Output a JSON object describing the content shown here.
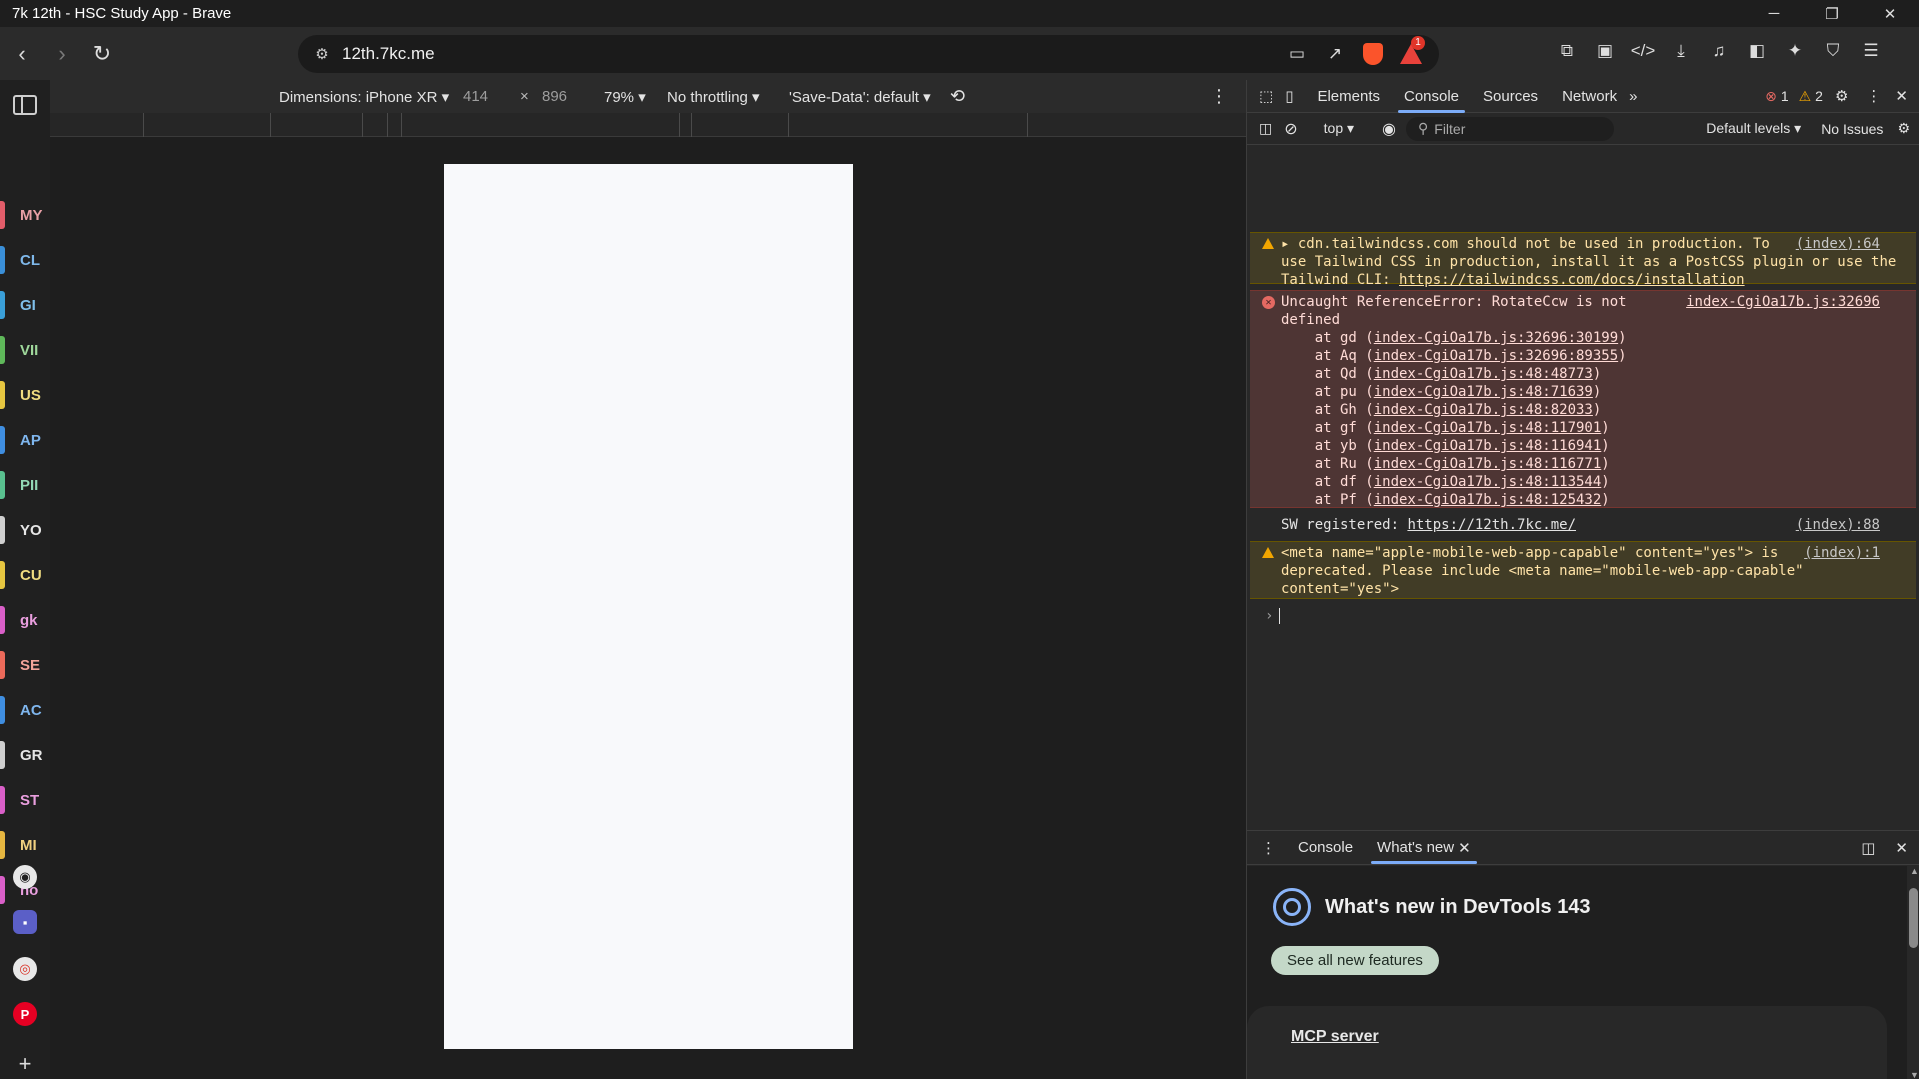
{
  "window": {
    "title": "7k 12th - HSC Study App - Brave"
  },
  "toolbar": {
    "url": "12th.7kc.me",
    "rewards_count": "1"
  },
  "sidebar": {
    "items": [
      {
        "label": "MY",
        "color": "#e35d6a",
        "text_color": "#e8a0a6"
      },
      {
        "label": "CL",
        "color": "#3a8fd8",
        "text_color": "#7fb8ea"
      },
      {
        "label": "GI",
        "color": "#3a9fd8",
        "text_color": "#7fbfea"
      },
      {
        "label": "VII",
        "color": "#5fb85a",
        "text_color": "#9fd89b"
      },
      {
        "label": "US",
        "color": "#e6c640",
        "text_color": "#f0dc80"
      },
      {
        "label": "AP",
        "color": "#3f8ee0",
        "text_color": "#7fb6ee"
      },
      {
        "label": "PII",
        "color": "#59c08f",
        "text_color": "#93d8b6"
      },
      {
        "label": "YO",
        "color": "#cfcfcf",
        "text_color": "#e6e6e6"
      },
      {
        "label": "CU",
        "color": "#e6c640",
        "text_color": "#f0dc80"
      },
      {
        "label": "gk",
        "color": "#d95fc8",
        "text_color": "#ea9fdf"
      },
      {
        "label": "SE",
        "color": "#ec6a5a",
        "text_color": "#f3a59a"
      },
      {
        "label": "AC",
        "color": "#3f8ee0",
        "text_color": "#7fb6ee"
      },
      {
        "label": "GR",
        "color": "#cfcfcf",
        "text_color": "#e6e6e6"
      },
      {
        "label": "ST",
        "color": "#d95fc8",
        "text_color": "#ea9fdf"
      },
      {
        "label": "MI",
        "color": "#e6b640",
        "text_color": "#f0d080"
      },
      {
        "label": "no",
        "color": "#d95fc8",
        "text_color": "#ea9fdf"
      }
    ]
  },
  "devbar": {
    "dimensions": "Dimensions: iPhone XR ▾",
    "width": "414",
    "times": "×",
    "height": "896",
    "zoom": "79% ▾",
    "throttle": "No throttling ▾",
    "savedata": "'Save-Data': default ▾"
  },
  "devtools": {
    "tabs": [
      "Elements",
      "Console",
      "Sources",
      "Network"
    ],
    "error_count": "1",
    "warn_count": "2",
    "context": "top ▾",
    "filter_placeholder": "Filter",
    "levels": "Default levels ▾",
    "issues": "No Issues"
  },
  "console": {
    "m1": {
      "lines": [
        "▸ cdn.tailwindcss.com should not be used in production. To",
        "use Tailwind CSS in production, install it as a PostCSS plugin or use the",
        "Tailwind CLI: "
      ],
      "link": "https://tailwindcss.com/docs/installation",
      "src": "(index):64"
    },
    "m2": {
      "lines": [
        "Uncaught ReferenceError: RotateCcw is not",
        "defined"
      ],
      "src": "index-CgiOa17b.js:32696",
      "stack": [
        {
          "fn": "    at gd (",
          "loc": "index-CgiOa17b.js:32696:30199"
        },
        {
          "fn": "    at Aq (",
          "loc": "index-CgiOa17b.js:32696:89355"
        },
        {
          "fn": "    at Qd (",
          "loc": "index-CgiOa17b.js:48:48773"
        },
        {
          "fn": "    at pu (",
          "loc": "index-CgiOa17b.js:48:71639"
        },
        {
          "fn": "    at Gh (",
          "loc": "index-CgiOa17b.js:48:82033"
        },
        {
          "fn": "    at gf (",
          "loc": "index-CgiOa17b.js:48:117901"
        },
        {
          "fn": "    at yb (",
          "loc": "index-CgiOa17b.js:48:116941"
        },
        {
          "fn": "    at Ru (",
          "loc": "index-CgiOa17b.js:48:116771"
        },
        {
          "fn": "    at df (",
          "loc": "index-CgiOa17b.js:48:113544"
        },
        {
          "fn": "    at Pf (",
          "loc": "index-CgiOa17b.js:48:125432"
        }
      ]
    },
    "m3": {
      "text": "SW registered: ",
      "link": "https://12th.7kc.me/",
      "src": "(index):88"
    },
    "m4": {
      "lines": [
        "<meta name=\"apple-mobile-web-app-capable\" content=\"yes\"> is",
        "deprecated. Please include <meta name=\"mobile-web-app-capable\"",
        "content=\"yes\">"
      ],
      "src": "(index):1"
    },
    "prompt": "›"
  },
  "drawer": {
    "tab_console": "Console",
    "tab_whatsnew": "What's new",
    "title": "What's new in DevTools 143",
    "button": "See all new features",
    "card_link": "MCP server"
  }
}
